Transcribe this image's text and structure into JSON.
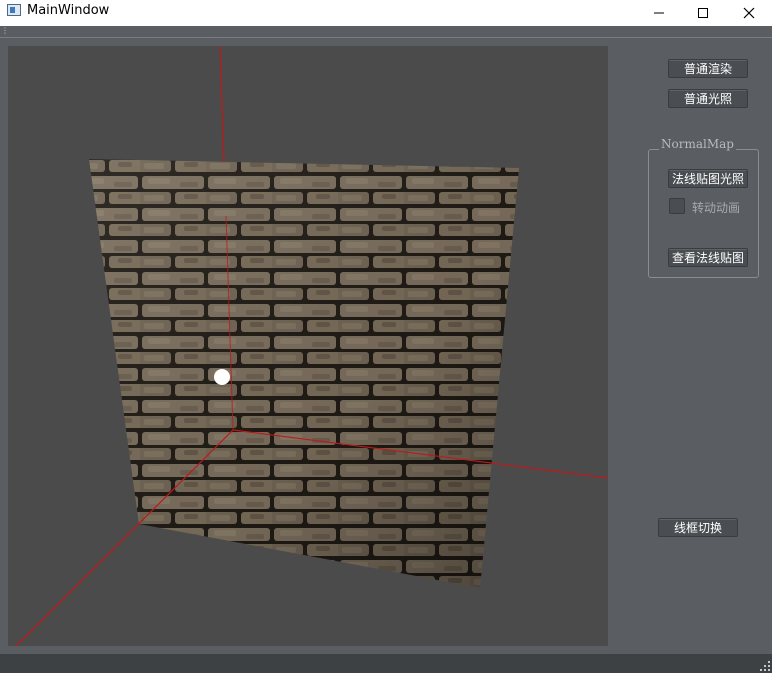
{
  "window": {
    "title": "MainWindow",
    "controls": {
      "minimize": "minimize",
      "maximize": "maximize",
      "close": "close"
    }
  },
  "viewport": {
    "scene": "brick-wall-normal-map-quad",
    "axis_color": "#c01818",
    "background": "#4b4b4b"
  },
  "controls": {
    "normal_render_label": "普通渲染",
    "normal_lighting_label": "普通光照",
    "normalmap_group_title": "NormalMap",
    "normalmap_lighting_label": "法线贴图光照",
    "rotate_animation_label": "转动动画",
    "rotate_animation_checked": false,
    "view_normalmap_label": "查看法线贴图",
    "wireframe_toggle_label": "线框切换"
  },
  "colors": {
    "panel_bg": "#5a5d61",
    "button_bg": "#4a4d51",
    "statusbar_bg": "#3e4144"
  }
}
